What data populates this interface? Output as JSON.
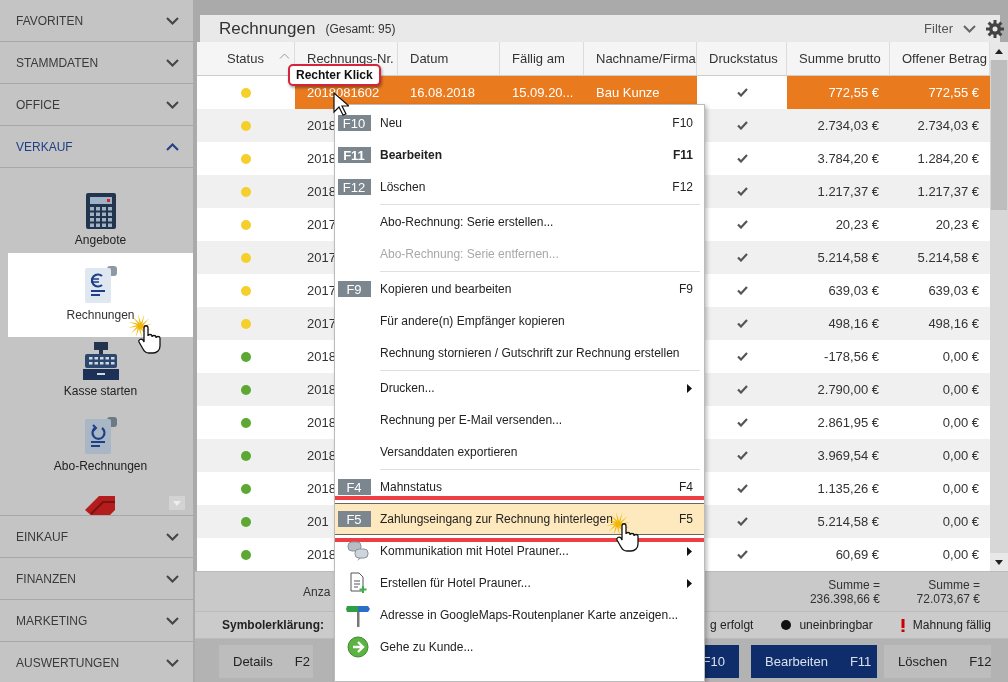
{
  "sidebar": {
    "sections": [
      {
        "label": "FAVORITEN",
        "expanded": false
      },
      {
        "label": "STAMMDATEN",
        "expanded": false
      },
      {
        "label": "OFFICE",
        "expanded": false
      },
      {
        "label": "VERKAUF",
        "expanded": true,
        "items": [
          {
            "kind": "calculator",
            "label": "Angebote",
            "selected": false
          },
          {
            "kind": "invoice",
            "label": "Rechnungen",
            "selected": true
          },
          {
            "kind": "register",
            "label": "Kasse starten",
            "selected": false
          },
          {
            "kind": "subscription",
            "label": "Abo-Rechnungen",
            "selected": false
          },
          {
            "kind": "tag",
            "selected": false
          }
        ]
      },
      {
        "label": "EINKAUF",
        "expanded": false
      },
      {
        "label": "FINANZEN",
        "expanded": false
      },
      {
        "label": "MARKETING",
        "expanded": false
      },
      {
        "label": "AUSWERTUNGEN",
        "expanded": false
      }
    ]
  },
  "list": {
    "title": "Rechnungen",
    "total": "(Gesamt: 95)",
    "filter": "Filter"
  },
  "table": {
    "columns": [
      {
        "label": "Status",
        "sorted": true
      },
      {
        "label": "Rechnungs-Nr.",
        "sorted": false
      },
      {
        "label": "Datum",
        "sorted": false
      },
      {
        "label": "Fällig am",
        "sorted": false
      },
      {
        "label": "Nachname/Firma",
        "sorted": false
      },
      {
        "label": "Druckstatus",
        "sorted": false
      },
      {
        "label": "Summe brutto",
        "sorted": false
      },
      {
        "label": "Offener Betrag",
        "sorted": false
      }
    ],
    "rows": [
      {
        "selected": true,
        "color": "#f5cf2c",
        "number": "2018081602",
        "date": "16.08.2018",
        "due": "15.09.20...",
        "name": "Bau Kunze",
        "printed": true,
        "gross": "772,55 €",
        "open": "772,55 €"
      },
      {
        "selected": false,
        "color": "#f5cf2c",
        "number": "2018",
        "printed": true,
        "gross": "2.734,03 €",
        "open": "2.734,03 €"
      },
      {
        "selected": false,
        "color": "#f5cf2c",
        "number": "2018",
        "printed": true,
        "gross": "3.784,20 €",
        "open": "1.284,20 €"
      },
      {
        "selected": false,
        "color": "#f5cf2c",
        "number": "2018",
        "printed": true,
        "gross": "1.217,37 €",
        "open": "1.217,37 €"
      },
      {
        "selected": false,
        "color": "#f5cf2c",
        "number": "2017",
        "printed": true,
        "gross": "20,23 €",
        "open": "20,23 €"
      },
      {
        "selected": false,
        "color": "#f5cf2c",
        "number": "2017",
        "printed": true,
        "gross": "5.214,58 €",
        "open": "5.214,58 €"
      },
      {
        "selected": false,
        "color": "#f5cf2c",
        "number": "2017",
        "printed": true,
        "gross": "639,03 €",
        "open": "639,03 €"
      },
      {
        "selected": false,
        "color": "#f5cf2c",
        "number": "2017",
        "printed": true,
        "gross": "498,16 €",
        "open": "498,16 €"
      },
      {
        "selected": false,
        "color": "#5ca832",
        "number": "2018",
        "printed": true,
        "gross": "-178,56 €",
        "open": "0,00 €"
      },
      {
        "selected": false,
        "color": "#5ca832",
        "number": "2018",
        "printed": true,
        "gross": "2.790,00 €",
        "open": "0,00 €"
      },
      {
        "selected": false,
        "color": "#5ca832",
        "number": "2018",
        "printed": true,
        "gross": "2.861,95 €",
        "open": "0,00 €"
      },
      {
        "selected": false,
        "color": "#5ca832",
        "number": "2018",
        "printed": true,
        "gross": "3.969,54 €",
        "open": "0,00 €"
      },
      {
        "selected": false,
        "color": "#5ca832",
        "number": "2018",
        "printed": true,
        "gross": "1.135,26 €",
        "open": "0,00 €"
      },
      {
        "selected": false,
        "color": "#5ca832",
        "number": "201",
        "printed": true,
        "gross": "5.214,58 €",
        "open": "0,00 €"
      },
      {
        "selected": false,
        "color": "#5ca832",
        "number": "2018",
        "printed": true,
        "gross": "60,69 €",
        "open": "0,00 €"
      }
    ]
  },
  "footer": {
    "count": "Anza",
    "gross_total": {
      "label": "Summe =",
      "value": "236.398,66 €"
    },
    "open_total": {
      "label": "Summe =",
      "value": "72.073,67 €"
    }
  },
  "legend": {
    "title": "Symbolerklärung:",
    "entries": [
      {
        "kind": "text",
        "label": "g erfolgt"
      },
      {
        "kind": "dot",
        "label": "uneinbringbar"
      },
      {
        "kind": "warning",
        "label": "Mahnung fällig"
      }
    ]
  },
  "buttons": [
    {
      "label": "Details",
      "key": "F2",
      "primary": false
    },
    {
      "key": "F10",
      "primary": true
    },
    {
      "label": "Bearbeiten",
      "key": "F11",
      "primary": true
    },
    {
      "label": "Löschen",
      "key": "F12",
      "primary": false
    }
  ],
  "context_menu": {
    "items": [
      {
        "kind": "command",
        "badge": "F10",
        "label": "Neu",
        "shortcut": "F10",
        "bold": false,
        "disabled": false,
        "submenu": false,
        "selected": false
      },
      {
        "kind": "command",
        "badge": "F11",
        "label": "Bearbeiten",
        "shortcut": "F11",
        "bold": true,
        "disabled": false,
        "submenu": false,
        "selected": false
      },
      {
        "kind": "command",
        "badge": "F12",
        "label": "Löschen",
        "shortcut": "F12",
        "bold": false,
        "disabled": false,
        "submenu": false,
        "selected": false
      },
      {
        "kind": "separator"
      },
      {
        "kind": "command",
        "label": "Abo-Rechnung: Serie erstellen...",
        "bold": false,
        "disabled": false,
        "submenu": false,
        "selected": false
      },
      {
        "kind": "command",
        "label": "Abo-Rechnung: Serie entfernen...",
        "bold": false,
        "disabled": true,
        "submenu": false,
        "selected": false
      },
      {
        "kind": "separator"
      },
      {
        "kind": "command",
        "badge": "F9",
        "label": "Kopieren und bearbeiten",
        "shortcut": "F9",
        "bold": false,
        "disabled": false,
        "submenu": false,
        "selected": false
      },
      {
        "kind": "command",
        "label": "Für andere(n) Empfänger kopieren",
        "bold": false,
        "disabled": false,
        "submenu": false,
        "selected": false
      },
      {
        "kind": "command",
        "label": "Rechnung stornieren / Gutschrift zur Rechnung erstellen",
        "bold": false,
        "disabled": false,
        "submenu": false,
        "selected": false
      },
      {
        "kind": "separator"
      },
      {
        "kind": "command",
        "label": "Drucken...",
        "bold": false,
        "disabled": false,
        "submenu": true,
        "selected": false
      },
      {
        "kind": "command",
        "label": "Rechnung per E-Mail versenden...",
        "bold": false,
        "disabled": false,
        "submenu": false,
        "selected": false
      },
      {
        "kind": "command",
        "label": "Versanddaten exportieren",
        "bold": false,
        "disabled": false,
        "submenu": false,
        "selected": false
      },
      {
        "kind": "separator"
      },
      {
        "kind": "command",
        "badge": "F4",
        "label": "Mahnstatus",
        "shortcut": "F4",
        "bold": false,
        "disabled": false,
        "submenu": false,
        "selected": false
      },
      {
        "kind": "command",
        "badge": "F5",
        "label": "Zahlungseingang zur Rechnung hinterlegen",
        "shortcut": "F5",
        "bold": false,
        "disabled": false,
        "submenu": false,
        "selected": true
      },
      {
        "kind": "chat",
        "label": "Kommunikation mit Hotel Prauner...",
        "bold": false,
        "disabled": false,
        "submenu": true,
        "selected": false
      },
      {
        "kind": "document",
        "label": "Erstellen für Hotel Prauner...",
        "bold": false,
        "disabled": false,
        "submenu": true,
        "selected": false
      },
      {
        "kind": "pin",
        "label": "Adresse in GoogleMaps-Routenplaner Karte anzeigen...",
        "bold": false,
        "disabled": false,
        "submenu": false,
        "selected": false
      },
      {
        "kind": "go",
        "label": "Gehe zu Kunde...",
        "bold": false,
        "disabled": false,
        "submenu": false,
        "selected": false
      }
    ]
  },
  "callout": {
    "text": "Rechter Klick"
  }
}
